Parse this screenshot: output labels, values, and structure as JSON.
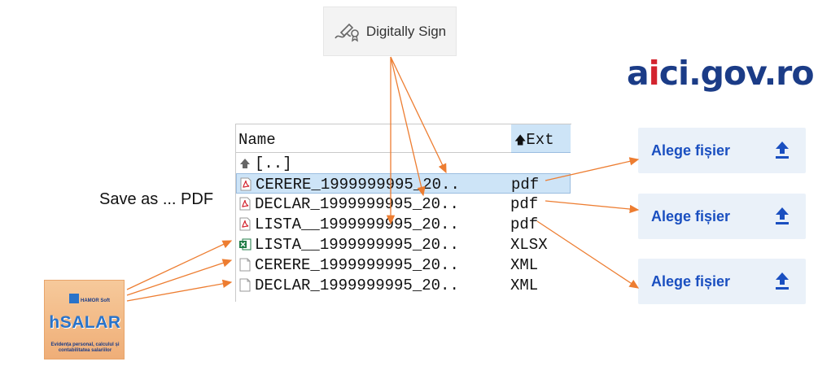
{
  "sign_button": {
    "label": "Digitally Sign",
    "icon": "signature-pen-icon"
  },
  "logo": {
    "prefix": "a",
    "highlight": "i",
    "rest": "ci.gov.ro"
  },
  "save_label": "Save as ... PDF",
  "file_panel": {
    "col_name": "Name",
    "col_ext": "Ext",
    "sort_icon": "sort-up-arrow-icon",
    "rows": [
      {
        "icon": "parent-folder-icon",
        "name": "[..]",
        "ext": ""
      },
      {
        "icon": "pdf-file-icon",
        "name": "CERERE_1999999995_20..",
        "ext": "pdf",
        "selected": true
      },
      {
        "icon": "pdf-file-icon",
        "name": "DECLAR_1999999995_20..",
        "ext": "pdf"
      },
      {
        "icon": "pdf-file-icon",
        "name": "LISTA__1999999995_20..",
        "ext": "pdf"
      },
      {
        "icon": "excel-file-icon",
        "name": "LISTA__1999999995_20..",
        "ext": "XLSX"
      },
      {
        "icon": "blank-file-icon",
        "name": "CERERE_1999999995_20..",
        "ext": "XML"
      },
      {
        "icon": "blank-file-icon",
        "name": "DECLAR_1999999995_20..",
        "ext": "XML"
      }
    ]
  },
  "upload_buttons": [
    {
      "label": "Alege fișier",
      "icon": "upload-icon"
    },
    {
      "label": "Alege fișier",
      "icon": "upload-icon"
    },
    {
      "label": "Alege fișier",
      "icon": "upload-icon"
    }
  ],
  "hsalar": {
    "brand": "HAMOR Soft",
    "title": "hSALAR",
    "subtitle": "Evidența personal, calculul și contabilitatea salariilor"
  },
  "colors": {
    "arrow": "#ed7d31",
    "link_blue": "#1a4fc0",
    "logo_blue": "#1b3c87",
    "logo_red": "#d3242f",
    "selection": "#cde4f7"
  }
}
